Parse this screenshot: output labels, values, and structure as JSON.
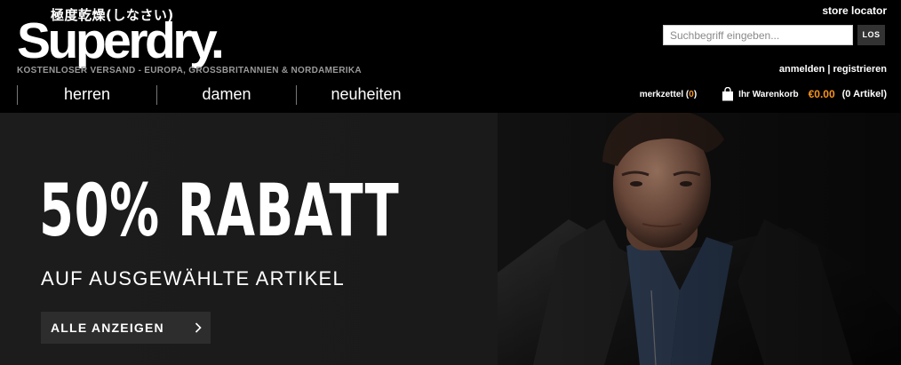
{
  "brand": {
    "japanese": "極度乾燥(しなさい)",
    "name": "Superdry.",
    "tagline": "KOSTENLOSER VERSAND - EUROPA, GROSSBRITANNIEN & NORDAMERIKA"
  },
  "nav": {
    "items": [
      {
        "label": "herren"
      },
      {
        "label": "damen"
      },
      {
        "label": "neuheiten"
      }
    ]
  },
  "utility": {
    "store_locator": "store locator",
    "search_placeholder": "Suchbegriff eingeben...",
    "search_button": "LOS",
    "login": "anmelden",
    "separator": "|",
    "register": "registrieren"
  },
  "cart": {
    "wishlist_label": "merkzettel",
    "wishlist_count": "0",
    "cart_label": "Ihr Warenkorb",
    "total": "€0.00",
    "item_count": "0",
    "items_label": "Artikel"
  },
  "hero": {
    "title": "50% RABATT",
    "subtitle": "AUF AUSGEWÄHLTE ARTIKEL",
    "cta": "ALLE ANZEIGEN"
  },
  "colors": {
    "accent": "#f7941d",
    "background": "#000000",
    "button": "#2d2d2d"
  }
}
